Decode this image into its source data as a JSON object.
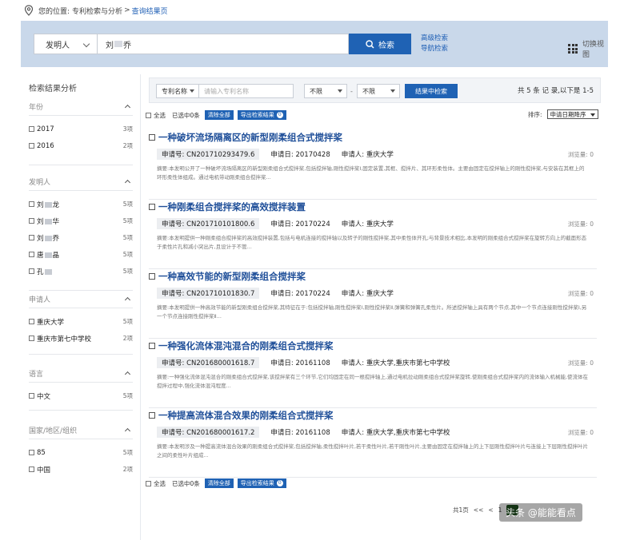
{
  "breadcrumb": {
    "label": "您的位置:",
    "path": "专利检索与分析",
    "separator": ">",
    "current": "查询结果页"
  },
  "search": {
    "field_select": "发明人",
    "query_prefix": "刘",
    "query_suffix": "乔",
    "search_button": "检索",
    "advanced_link": "高级检索",
    "nav_link": "导航检索",
    "switch_view": "切换视图"
  },
  "sidebar": {
    "title": "检索结果分析",
    "groups": [
      {
        "name": "年份",
        "items": [
          {
            "label": "2017",
            "count": "3项"
          },
          {
            "label": "2016",
            "count": "2项"
          }
        ]
      },
      {
        "name": "发明人",
        "items": [
          {
            "label_a": "刘",
            "label_b": "龙",
            "count": "5项"
          },
          {
            "label_a": "刘",
            "label_b": "华",
            "count": "5项"
          },
          {
            "label_a": "刘",
            "label_b": "乔",
            "count": "5项"
          },
          {
            "label_a": "唐",
            "label_b": "晶",
            "count": "5项"
          },
          {
            "label_a": "孔",
            "label_b": "",
            "count": "5项"
          }
        ]
      },
      {
        "name": "申请人",
        "items": [
          {
            "label": "重庆大学",
            "count": "5项"
          },
          {
            "label": "重庆市第七中学校",
            "count": "2项"
          }
        ]
      },
      {
        "name": "语言",
        "items": [
          {
            "label": "中文",
            "count": "5项"
          }
        ]
      },
      {
        "name": "国家/地区/组织",
        "items": [
          {
            "label": "85",
            "count": "5项"
          },
          {
            "label": "中国",
            "count": "2项"
          }
        ]
      }
    ]
  },
  "toolbar": {
    "field_select": "专利名称",
    "input_placeholder": "请输入专利名称",
    "range_from": "不限",
    "range_to": "不限",
    "dash": "-",
    "search_in_results": "结果中检索",
    "count_text": "共 5 条 记 录,以下是 1-5"
  },
  "selection": {
    "select_all": "全选",
    "selected": "已选中0条",
    "clear_all": "清除全部",
    "export": "导出检索结果",
    "export_count": "0",
    "sort_label": "排序:",
    "sort_value": "申请日期降序"
  },
  "results": [
    {
      "title": "一种破坏流场隔离区的新型刚柔组合式搅拌桨",
      "app_no_label": "申请号:",
      "app_no": "CN201710293479.6",
      "date_label": "申请日:",
      "date": "20170428",
      "applicant_label": "申请人:",
      "applicant": "重庆大学",
      "views": "浏览量: 0",
      "abstract": "摘要:本发明公开了一种破坏流场隔离区的新型刚柔组合式搅拌桨,包括搅拌轴,刚性搅拌桨Ⅰ,固定装置,其框、搅拌片、其环形柔性体。主要由固定在搅拌轴上的刚性搅拌桨,与安装在其框上的环形柔性体组成。通过电机带动刚柔组合搅拌桨..."
    },
    {
      "title": "一种刚柔组合搅拌桨的高效搅拌装置",
      "app_no_label": "申请号:",
      "app_no": "CN201710101800.6",
      "date_label": "申请日:",
      "date": "20170224",
      "applicant_label": "申请人:",
      "applicant": "重庆大学",
      "views": "浏览量: 0",
      "abstract": "摘要:本发明提供一种刚柔组合搅拌桨的高效搅拌装置,包括与电机连接的搅拌轴以及转子的刚性搅拌桨,其中柔性体开孔;与背景技术相比,本发明的刚柔组合式搅拌桨在旋转方向上的截面形态于柔性片孔和减小突出片,且设计于不管..."
    },
    {
      "title": "一种高效节能的新型刚柔组合搅拌桨",
      "app_no_label": "申请号:",
      "app_no": "CN201710101830.7",
      "date_label": "申请日:",
      "date": "20170224",
      "applicant_label": "申请人:",
      "applicant": "重庆大学",
      "views": "浏览量: 0",
      "abstract": "摘要:本发明提供一种高效节能的新型刚柔组合搅拌桨,其特征在于:包括搅拌轴,刚性搅拌桨Ⅰ,刚性搅拌桨Ⅱ,弹簧和弹簧孔柔性片。所述搅拌轴上具有两个节点,其中一个节点连接刚性搅拌桨Ⅰ,另一个节点连接刚性搅拌桨Ⅱ..."
    },
    {
      "title": "一种强化流体混沌混合的刚柔组合式搅拌桨",
      "app_no_label": "申请号:",
      "app_no": "CN201680001618.7",
      "date_label": "申请日:",
      "date": "20161108",
      "applicant_label": "申请人:",
      "applicant": "重庆大学,重庆市第七中学校",
      "views": "浏览量: 0",
      "abstract": "摘要:一种强化流体混沌混合的刚柔组合式搅拌桨,该搅拌桨有三个环节,它们均固定在同一根搅拌轴上,通过电机拉动刚柔组合式搅拌桨旋转,使刚柔组合式搅拌桨内的流体输入机械能,使流体在搅拌过程中,强化流体混沌程度..."
    },
    {
      "title": "一种提高流体混合效果的刚柔组合式搅拌桨",
      "app_no_label": "申请号:",
      "app_no": "CN201680001617.2",
      "date_label": "申请日:",
      "date": "20161108",
      "applicant_label": "申请人:",
      "applicant": "重庆大学,重庆市第七中学校",
      "views": "浏览量: 0",
      "abstract": "摘要:本发明涉及一种提高流体混合效果的刚柔组合式搅拌桨,包括搅拌轴,柔性搅拌叶片,若干柔性叶片,若干刚性叶片,主要由固定在搅拌轴上的上下层刚性搅拌叶片与连接上下层刚性搅拌叶片之间的柔性叶片组成..."
    }
  ],
  "bottom_selection": {
    "select_all": "全选",
    "selected": "已选中0条",
    "clear_all": "清除全部",
    "export": "导出检索结果",
    "export_count": "0"
  },
  "pager": {
    "total": "共1页",
    "prev": "<<",
    "prev2": "<",
    "page": "1",
    "next": ">"
  },
  "watermark": "头条 @能能看点",
  "colors": {
    "primary": "#1f62b4",
    "header_band": "#c9d8ea",
    "title_link": "#1f4f99"
  }
}
